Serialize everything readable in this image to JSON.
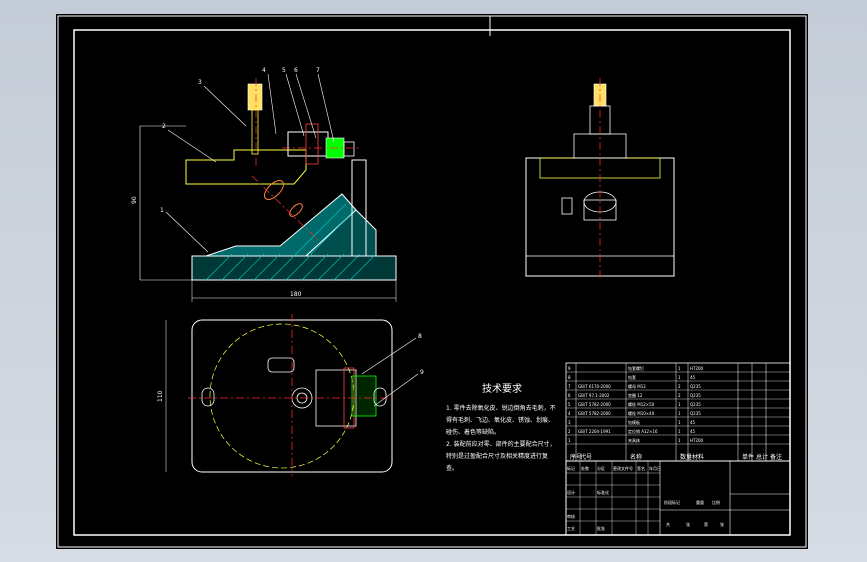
{
  "app": {
    "background_color": "#c9d1db",
    "sheet_color": "#000000"
  },
  "colors": {
    "frame": "#ffffff",
    "part": "#ffffff",
    "hatch": "#00c8c8",
    "center_line": "#ff3030",
    "dimension": "#ffffff",
    "hidden_line": "#ffff40",
    "bolt": "#ffe060",
    "green_part": "#00ff00",
    "title_text": "#ffffff"
  },
  "views": {
    "front": {
      "balloons": [
        "3",
        "4",
        "5",
        "6",
        "7",
        "2",
        "1"
      ],
      "dim_height": "90",
      "dim_width": "180"
    },
    "top": {
      "balloons": [
        "8",
        "9"
      ],
      "dim_height": "110"
    },
    "side": {}
  },
  "tech_notes": {
    "title": "技术要求",
    "lines": [
      "1. 零件去除氧化皮、锐边倒角去毛刺，不",
      "得有毛刺、飞边、氧化皮、锈蚀、划痕、",
      "碰伤、着色等缺陷。",
      "2. 装配前应对零、部件的主要配合尺寸，",
      "特别是过盈配合尺寸及相关精度进行复",
      "查。"
    ]
  },
  "bom": {
    "headers": [
      "序号",
      "代号",
      "名称",
      "数量",
      "材料",
      "单件",
      "总计",
      "备注"
    ],
    "rows": [
      [
        "9",
        "",
        "钻套螺钉",
        "1",
        "HT200",
        "",
        "",
        ""
      ],
      [
        "8",
        "",
        "钻套",
        "1",
        "45",
        "",
        "",
        ""
      ],
      [
        "7",
        "GB/T 6170-2000",
        "螺母 M12",
        "2",
        "Q235",
        "",
        "",
        ""
      ],
      [
        "6",
        "GB/T 97.1-2002",
        "垫圈 12",
        "2",
        "Q235",
        "",
        "",
        ""
      ],
      [
        "5",
        "GB/T 5782-2000",
        "螺栓 M12×50",
        "1",
        "Q235",
        "",
        "",
        ""
      ],
      [
        "4",
        "GB/T 5782-2000",
        "螺栓 M10×40",
        "1",
        "Q235",
        "",
        "",
        ""
      ],
      [
        "3",
        "",
        "钻模板",
        "1",
        "45",
        "",
        "",
        ""
      ],
      [
        "2",
        "GB/T 2204-1991",
        "定位销 A12×16",
        "1",
        "45",
        "",
        "",
        ""
      ],
      [
        "1",
        "",
        "夹具体",
        "1",
        "HT200",
        "",
        "",
        ""
      ]
    ]
  },
  "title_block": {
    "labels": [
      "标记",
      "处数",
      "分区",
      "更改文件号",
      "签名",
      "年月日",
      "设计",
      "标准化",
      "审核",
      "工艺",
      "批准"
    ],
    "right_labels": [
      "阶段标记",
      "重量",
      "比例",
      "共",
      "张",
      "第",
      "张"
    ]
  }
}
